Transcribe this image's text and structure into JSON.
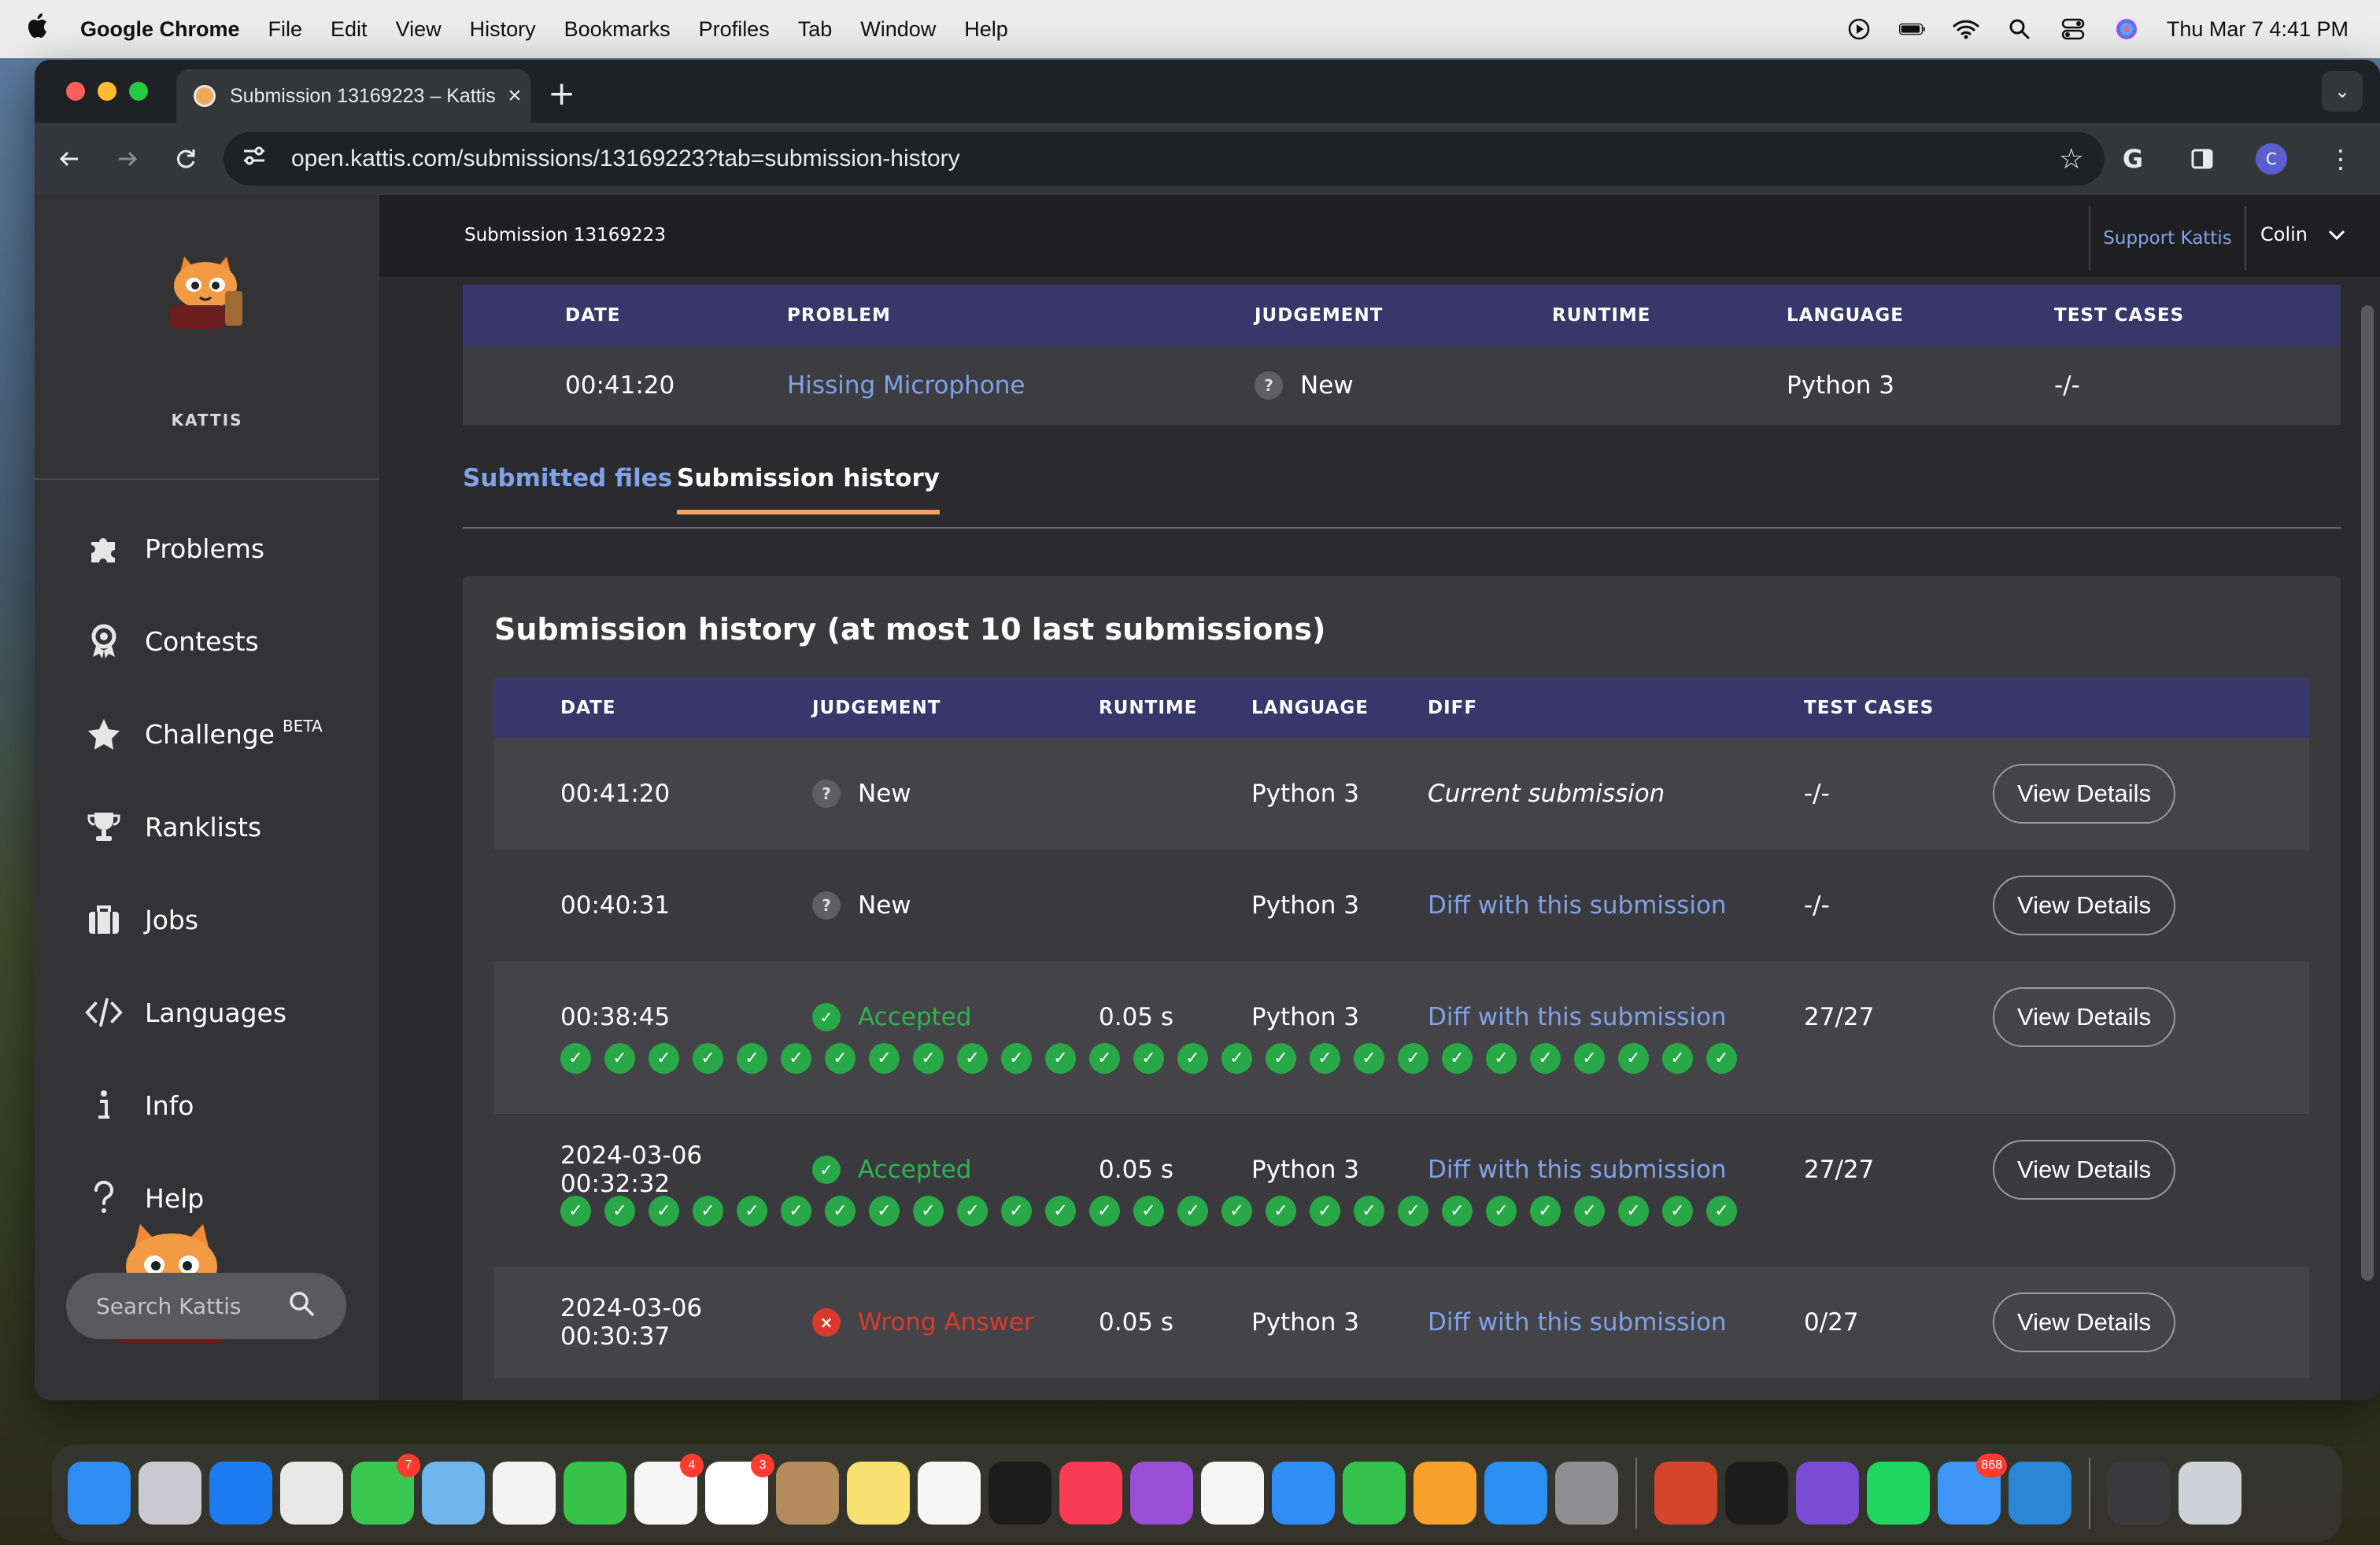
{
  "menubar": {
    "app_name": "Google Chrome",
    "menus": [
      "File",
      "Edit",
      "View",
      "History",
      "Bookmarks",
      "Profiles",
      "Tab",
      "Window",
      "Help"
    ],
    "datetime": "Thu Mar 7  4:41 PM"
  },
  "browser": {
    "tab_title": "Submission 13169223 – Kattis",
    "url": "open.kattis.com/submissions/13169223?tab=submission-history",
    "profile_initial": "C"
  },
  "sidebar": {
    "brand": "KATTIS",
    "items": [
      {
        "label": "Problems",
        "icon": "puzzle-icon"
      },
      {
        "label": "Contests",
        "icon": "award-icon"
      },
      {
        "label": "Challenge",
        "icon": "star-icon",
        "tag": "BETA"
      },
      {
        "label": "Ranklists",
        "icon": "trophy-icon"
      },
      {
        "label": "Jobs",
        "icon": "briefcase-icon"
      },
      {
        "label": "Languages",
        "icon": "code-icon"
      },
      {
        "label": "Info",
        "icon": "info-icon"
      },
      {
        "label": "Help",
        "icon": "question-icon"
      }
    ],
    "search_placeholder": "Search Kattis"
  },
  "topbar": {
    "breadcrumb": "Submission 13169223",
    "support": "Support Kattis",
    "user": "Colin"
  },
  "summary": {
    "headers": [
      "DATE",
      "PROBLEM",
      "JUDGEMENT",
      "RUNTIME",
      "LANGUAGE",
      "TEST CASES"
    ],
    "row": {
      "date": "00:41:20",
      "problem": "Hissing Microphone",
      "judgement": "New",
      "runtime": "",
      "language": "Python 3",
      "test_cases": "-/-"
    }
  },
  "tabs": {
    "submitted_files": "Submitted files",
    "submission_history": "Submission history"
  },
  "history": {
    "title": "Submission history (at most 10 last submissions)",
    "headers": [
      "DATE",
      "JUDGEMENT",
      "RUNTIME",
      "LANGUAGE",
      "DIFF",
      "TEST CASES"
    ],
    "action_label": "View Details",
    "rows": [
      {
        "date": "00:41:20",
        "judgement": "New",
        "status": "new",
        "runtime": "",
        "language": "Python 3",
        "diff": "Current submission",
        "test_cases": "-/-",
        "passed": 0
      },
      {
        "date": "00:40:31",
        "judgement": "New",
        "status": "new",
        "runtime": "",
        "language": "Python 3",
        "diff": "Diff with this submission",
        "test_cases": "-/-",
        "passed": 0
      },
      {
        "date": "00:38:45",
        "judgement": "Accepted",
        "status": "accepted",
        "runtime": "0.05 s",
        "language": "Python 3",
        "diff": "Diff with this submission",
        "test_cases": "27/27",
        "passed": 27
      },
      {
        "date": "2024-03-06 00:32:32",
        "judgement": "Accepted",
        "status": "accepted",
        "runtime": "0.05 s",
        "language": "Python 3",
        "diff": "Diff with this submission",
        "test_cases": "27/27",
        "passed": 27
      },
      {
        "date": "2024-03-06 00:30:37",
        "judgement": "Wrong Answer",
        "status": "wrong",
        "runtime": "0.05 s",
        "language": "Python 3",
        "diff": "Diff with this submission",
        "test_cases": "0/27",
        "passed": 0
      }
    ]
  },
  "dock": {
    "apps": [
      {
        "name": "finder",
        "color": "#2f8df2"
      },
      {
        "name": "launchpad",
        "color": "#c9c9cf"
      },
      {
        "name": "safari",
        "color": "#1d7cf2"
      },
      {
        "name": "chrome",
        "color": "#e8e8e8"
      },
      {
        "name": "messages",
        "color": "#38c74f",
        "badge": "7"
      },
      {
        "name": "maps",
        "color": "#6fb6ef"
      },
      {
        "name": "photos",
        "color": "#f2f2f2"
      },
      {
        "name": "facetime",
        "color": "#36c24b"
      },
      {
        "name": "reminders",
        "color": "#f5f5f5",
        "badge": "4"
      },
      {
        "name": "calendar",
        "color": "#ffffff",
        "badge": "3"
      },
      {
        "name": "contacts",
        "color": "#b48b5c"
      },
      {
        "name": "notes",
        "color": "#f8e071"
      },
      {
        "name": "freeform",
        "color": "#f5f5f5"
      },
      {
        "name": "tv",
        "color": "#1b1b1b"
      },
      {
        "name": "music",
        "color": "#fa3b55"
      },
      {
        "name": "podcasts",
        "color": "#9b4fd6"
      },
      {
        "name": "news",
        "color": "#f5f5f5"
      },
      {
        "name": "keynote",
        "color": "#2e8ef5"
      },
      {
        "name": "numbers",
        "color": "#34c44d"
      },
      {
        "name": "pages",
        "color": "#f7a12c"
      },
      {
        "name": "app-store",
        "color": "#2c8ff3"
      },
      {
        "name": "system-settings",
        "color": "#8e8e93"
      },
      {
        "name": "powerpoint",
        "color": "#d4452b"
      },
      {
        "name": "terminal",
        "color": "#1c1c1c"
      },
      {
        "name": "github-desktop",
        "color": "#7a4cd6"
      },
      {
        "name": "spotify",
        "color": "#1ed760"
      },
      {
        "name": "mail",
        "color": "#3e95f5",
        "badge": "868"
      },
      {
        "name": "vscode",
        "color": "#2a86d6"
      },
      {
        "name": "screenshot",
        "color": "#3a3a3e"
      },
      {
        "name": "trash",
        "color": "#cfd2d6"
      }
    ]
  }
}
